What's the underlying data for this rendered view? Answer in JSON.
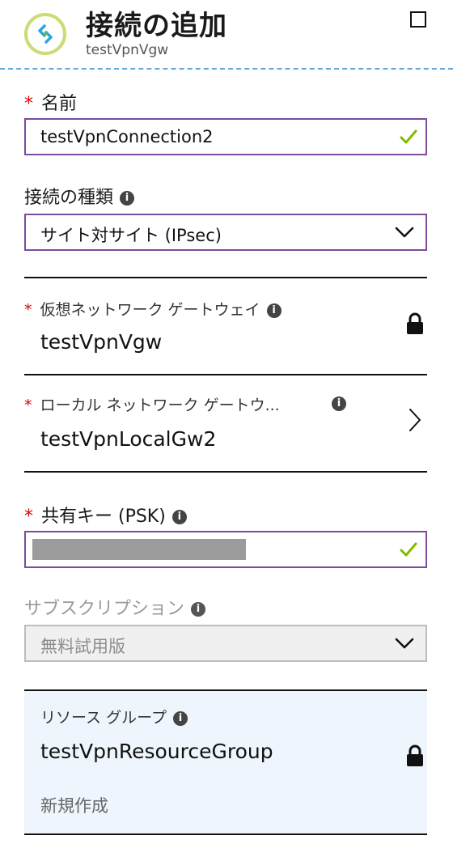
{
  "header": {
    "title": "接続の追加",
    "subtitle": "testVpnVgw"
  },
  "form": {
    "name": {
      "label": "名前",
      "value": "testVpnConnection2"
    },
    "connection_type": {
      "label": "接続の種類",
      "value": "サイト対サイト (IPsec)"
    },
    "virtual_network_gateway": {
      "label": "仮想ネットワーク ゲートウェイ",
      "value": "testVpnVgw"
    },
    "local_network_gateway": {
      "label": "ローカル ネットワーク ゲートウ...",
      "value": "testVpnLocalGw2"
    },
    "shared_key": {
      "label": "共有キー (PSK)"
    },
    "subscription": {
      "label": "サブスクリプション",
      "value": "無料試用版"
    },
    "resource_group": {
      "label": "リソース グループ",
      "value": "testVpnResourceGroup",
      "create_new": "新規作成"
    }
  },
  "symbols": {
    "required": "*",
    "info": "i"
  },
  "colors": {
    "field_border": "#7a4ca0",
    "check": "#7fba00",
    "required": "#e00000",
    "dashed_divider": "#62a7d6",
    "resource_group_bg": "#eef5fc"
  }
}
